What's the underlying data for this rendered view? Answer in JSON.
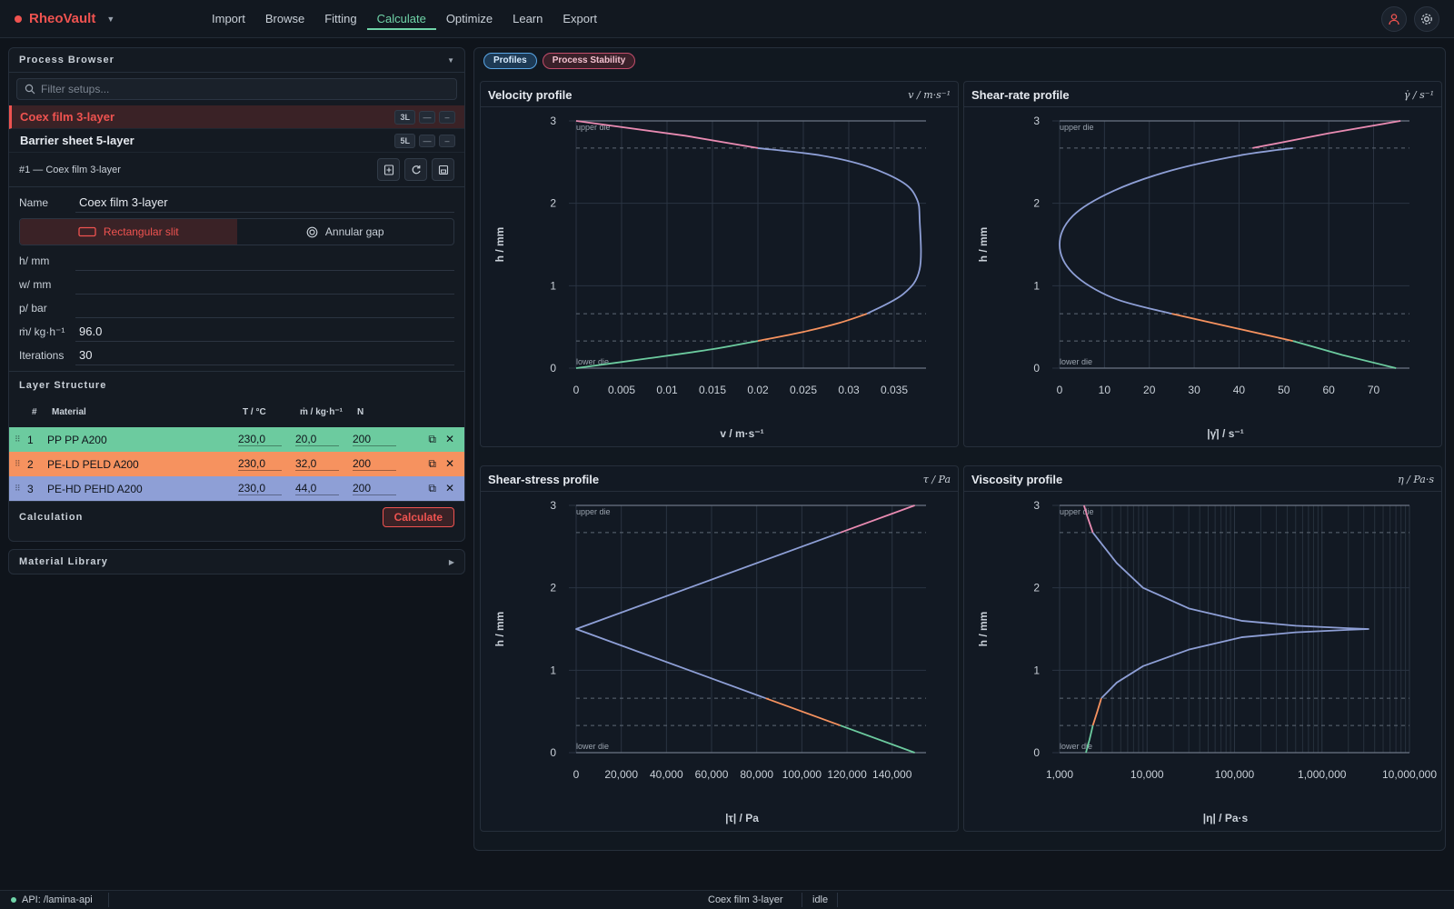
{
  "app": {
    "name": "RheoVault"
  },
  "nav": [
    {
      "label": "Import",
      "active": false
    },
    {
      "label": "Browse",
      "active": false
    },
    {
      "label": "Fitting",
      "active": false
    },
    {
      "label": "Calculate",
      "active": true
    },
    {
      "label": "Optimize",
      "active": false
    },
    {
      "label": "Learn",
      "active": false
    },
    {
      "label": "Export",
      "active": false
    }
  ],
  "process_browser": {
    "title": "Process Browser",
    "filter_placeholder": "Filter setups...",
    "setups": [
      {
        "name": "Coex film 3-layer",
        "tag": "3L",
        "selected": true
      },
      {
        "name": "Barrier sheet 5-layer",
        "tag": "5L",
        "selected": false
      }
    ],
    "current": "#1 — Coex film 3-layer",
    "form": {
      "name_label": "Name",
      "name_value": "Coex film 3-layer",
      "geometry": {
        "slit": "Rectangular slit",
        "annular": "Annular gap"
      },
      "h_label": "h/ mm",
      "h_value": "",
      "w_label": "w/ mm",
      "w_value": "",
      "p_label": "p/ bar",
      "p_value": "",
      "m_label": "ṁ/ kg·h⁻¹",
      "m_value": "96.0",
      "iter_label": "Iterations",
      "iter_value": "30"
    }
  },
  "layers": {
    "title": "Layer Structure",
    "headers": {
      "num": "#",
      "material": "Material",
      "t": "T / °C",
      "m": "ṁ / kg·h⁻¹",
      "n": "N"
    },
    "rows": [
      {
        "num": "1",
        "material": "PP PP A200",
        "t": "230,0",
        "m": "20,0",
        "n": "200",
        "color": "#6ccb9f"
      },
      {
        "num": "2",
        "material": "PE-LD PELD A200",
        "t": "230,0",
        "m": "32,0",
        "n": "200",
        "color": "#f6925f"
      },
      {
        "num": "3",
        "material": "PE-HD PEHD A200",
        "t": "230,0",
        "m": "44,0",
        "n": "200",
        "color": "#8e9fd6"
      }
    ]
  },
  "calculation": {
    "title": "Calculation",
    "button": "Calculate"
  },
  "material_library": {
    "title": "Material Library"
  },
  "tabs": [
    {
      "label": "Profiles",
      "active": true
    },
    {
      "label": "Process Stability",
      "active": false
    }
  ],
  "colors": {
    "layer1": "#6ccb9f",
    "layer2": "#f6925f",
    "layer3": "#8e9fd6",
    "wall": "#e98bb2",
    "accent": "#ef5350"
  },
  "status": {
    "api": "API: /lamina-api",
    "setup": "Coex film 3-layer",
    "state": "idle"
  },
  "chart_data": [
    {
      "type": "line",
      "title": "Velocity profile",
      "unit": "v / m·s⁻¹",
      "xlabel": "v / m·s⁻¹",
      "ylabel": "h / mm",
      "xticks": [
        "0",
        "0.005",
        "0.01",
        "0.015",
        "0.02",
        "0.025",
        "0.03",
        "0.035"
      ],
      "yticks": [
        "0",
        "1",
        "2",
        "3"
      ],
      "xlim": [
        0,
        0.0385
      ],
      "ylim": [
        0,
        3
      ],
      "xscale": "linear",
      "wall_labels": {
        "upper": "upper die",
        "lower": "lower die"
      },
      "interfaces": [
        0.33,
        0.66,
        2.67
      ],
      "series": [
        {
          "color": "#6ccb9f",
          "x": [
            0,
            0.008,
            0.015,
            0.02
          ],
          "y": [
            0,
            0.12,
            0.23,
            0.33
          ]
        },
        {
          "color": "#f6925f",
          "x": [
            0.02,
            0.025,
            0.029,
            0.032
          ],
          "y": [
            0.33,
            0.44,
            0.55,
            0.66
          ]
        },
        {
          "color": "#8e9fd6",
          "x": [
            0.032,
            0.036,
            0.0378,
            0.0378,
            0.0375,
            0.036,
            0.032,
            0.027,
            0.02
          ],
          "y": [
            0.66,
            0.9,
            1.2,
            1.8,
            2.05,
            2.25,
            2.45,
            2.58,
            2.67
          ]
        },
        {
          "color": "#e98bb2",
          "x": [
            0.02,
            0.012,
            0
          ],
          "y": [
            2.67,
            2.82,
            3
          ]
        }
      ]
    },
    {
      "type": "line",
      "title": "Shear-rate profile",
      "unit": "γ̇ / s⁻¹",
      "xlabel": "|γ̇| / s⁻¹",
      "ylabel": "h / mm",
      "xticks": [
        "0",
        "10",
        "20",
        "30",
        "40",
        "50",
        "60",
        "70"
      ],
      "yticks": [
        "0",
        "1",
        "2",
        "3"
      ],
      "xlim": [
        0,
        78
      ],
      "ylim": [
        0,
        3
      ],
      "xscale": "linear",
      "wall_labels": {
        "upper": "upper die",
        "lower": "lower die"
      },
      "interfaces": [
        0.33,
        0.66,
        2.67
      ],
      "series": [
        {
          "color": "#6ccb9f",
          "x": [
            75,
            63,
            52
          ],
          "y": [
            0,
            0.16,
            0.33
          ]
        },
        {
          "color": "#f6925f",
          "x": [
            52,
            38,
            25
          ],
          "y": [
            0.33,
            0.5,
            0.66
          ]
        },
        {
          "color": "#8e9fd6",
          "x": [
            25,
            12,
            3,
            0,
            3,
            12,
            25,
            40,
            52
          ],
          "y": [
            0.66,
            0.85,
            1.15,
            1.5,
            1.85,
            2.15,
            2.4,
            2.58,
            2.67
          ]
        },
        {
          "color": "#e98bb2",
          "x": [
            43,
            60,
            76
          ],
          "y": [
            2.67,
            2.85,
            3
          ]
        }
      ]
    },
    {
      "type": "line",
      "title": "Shear-stress profile",
      "unit": "τ / Pa",
      "xlabel": "|τ| / Pa",
      "ylabel": "h / mm",
      "xticks": [
        "0",
        "20,000",
        "40,000",
        "60,000",
        "80,000",
        "100,000",
        "120,000",
        "140,000"
      ],
      "yticks": [
        "0",
        "1",
        "2",
        "3"
      ],
      "xlim": [
        0,
        155000
      ],
      "ylim": [
        0,
        3
      ],
      "xscale": "linear",
      "wall_labels": {
        "upper": "upper die",
        "lower": "lower die"
      },
      "interfaces": [
        0.33,
        0.66,
        2.67
      ],
      "series": [
        {
          "color": "#6ccb9f",
          "x": [
            150000,
            117000
          ],
          "y": [
            0,
            0.33
          ]
        },
        {
          "color": "#f6925f",
          "x": [
            117000,
            84000
          ],
          "y": [
            0.33,
            0.66
          ]
        },
        {
          "color": "#8e9fd6",
          "x": [
            84000,
            0,
            117000
          ],
          "y": [
            0.66,
            1.5,
            2.67
          ]
        },
        {
          "color": "#e98bb2",
          "x": [
            117000,
            150000
          ],
          "y": [
            2.67,
            3
          ]
        }
      ]
    },
    {
      "type": "line",
      "title": "Viscosity profile",
      "unit": "η / Pa·s",
      "xlabel": "|η| / Pa·s",
      "ylabel": "h / mm",
      "xticks": [
        "1,000",
        "10,000",
        "100,000",
        "1,000,000",
        "10,000,000"
      ],
      "yticks": [
        "0",
        "1",
        "2",
        "3"
      ],
      "xlim": [
        1000,
        10000000
      ],
      "ylim": [
        0,
        3
      ],
      "xscale": "log",
      "wall_labels": {
        "upper": "upper die",
        "lower": "lower die"
      },
      "interfaces": [
        0.33,
        0.66,
        2.67
      ],
      "series": [
        {
          "color": "#6ccb9f",
          "x": [
            2000,
            2200,
            2400
          ],
          "y": [
            0,
            0.16,
            0.33
          ]
        },
        {
          "color": "#f6925f",
          "x": [
            2400,
            2700,
            3000
          ],
          "y": [
            0.33,
            0.5,
            0.66
          ]
        },
        {
          "color": "#8e9fd6",
          "x": [
            3000,
            4500,
            9000,
            30000,
            120000,
            500000,
            2000000,
            3400000,
            2000000,
            500000,
            120000,
            30000,
            9000,
            4500,
            2400
          ],
          "y": [
            0.66,
            0.85,
            1.05,
            1.25,
            1.4,
            1.46,
            1.49,
            1.5,
            1.51,
            1.54,
            1.6,
            1.75,
            2.0,
            2.3,
            2.67
          ]
        },
        {
          "color": "#e98bb2",
          "x": [
            2400,
            2100,
            1900
          ],
          "y": [
            2.67,
            2.85,
            3
          ]
        }
      ]
    }
  ]
}
